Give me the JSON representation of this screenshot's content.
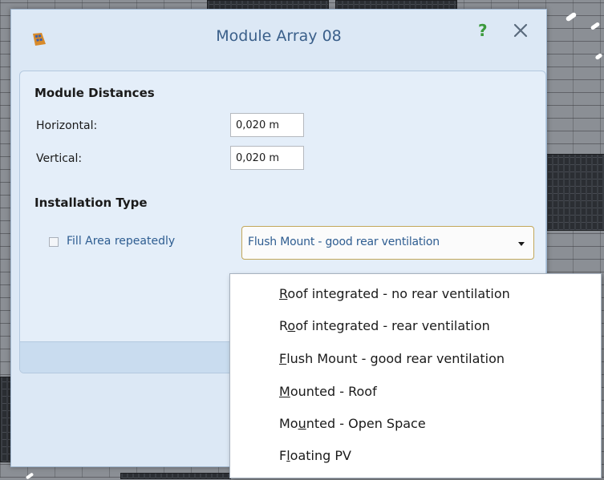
{
  "window": {
    "title": "Module Array 08",
    "help_label": "?"
  },
  "module_distances": {
    "heading": "Module Distances",
    "horizontal_label": "Horizontal:",
    "horizontal_value": "0,020 m",
    "vertical_label": "Vertical:",
    "vertical_value": "0,020 m"
  },
  "installation": {
    "heading": "Installation Type",
    "selected": "Flush Mount - good rear ventilation",
    "options": [
      {
        "pre": "",
        "key": "R",
        "post": "oof integrated - no rear ventilation"
      },
      {
        "pre": "R",
        "key": "o",
        "post": "of integrated - rear ventilation"
      },
      {
        "pre": "",
        "key": "F",
        "post": "lush Mount - good rear ventilation"
      },
      {
        "pre": "",
        "key": "M",
        "post": "ounted - Roof"
      },
      {
        "pre": "Mo",
        "key": "u",
        "post": "nted - Open Space"
      },
      {
        "pre": "F",
        "key": "l",
        "post": "oating PV"
      }
    ]
  },
  "fill_area": {
    "label": "Fill Area repeatedly",
    "checked": false
  },
  "icons": {
    "app": "solar-panel-icon",
    "close": "close-icon",
    "dropdown": "chevron-down-icon"
  },
  "colors": {
    "title": "#3a5f8a",
    "help": "#3c9a3c",
    "link_text": "#2e5d91",
    "dialog_bg": "#dce8f5"
  }
}
